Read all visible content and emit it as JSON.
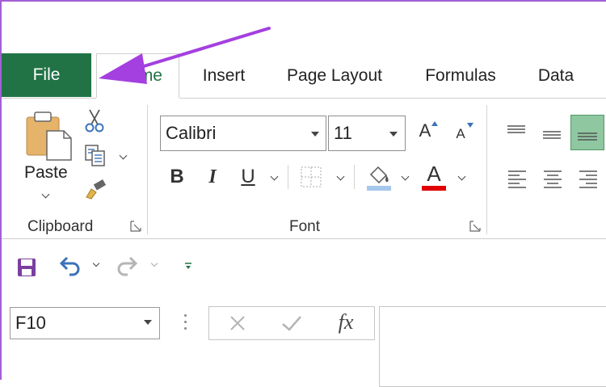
{
  "tabs": [
    {
      "id": "file",
      "label": "File"
    },
    {
      "id": "home",
      "label": "me"
    },
    {
      "id": "insert",
      "label": "Insert"
    },
    {
      "id": "page_layout",
      "label": "Page Layout"
    },
    {
      "id": "formulas",
      "label": "Formulas"
    },
    {
      "id": "data",
      "label": "Data"
    }
  ],
  "clipboard": {
    "paste_label": "Paste",
    "group_label": "Clipboard"
  },
  "font": {
    "font_name": "Calibri",
    "font_size": "11",
    "bold_label": "B",
    "italic_label": "I",
    "underline_label": "U",
    "increase_label": "A",
    "decrease_label": "A",
    "font_color_label": "A",
    "group_label": "Font"
  },
  "formula_bar": {
    "name_box": "F10",
    "fx_label": "fx"
  },
  "colors": {
    "file_tab": "#217346",
    "home_tab_text": "#217346",
    "arrow": "#a43fe0",
    "font_color_bar": "#e00000",
    "fill_color_bar": "#a6c8ec",
    "align_selected": "#8fc7a0"
  },
  "icons": {
    "paste": "clipboard-icon",
    "cut": "scissors-icon",
    "copy": "copy-icon",
    "format_painter": "paintbrush-icon",
    "save": "save-icon",
    "undo": "undo-icon",
    "redo": "redo-icon",
    "customize": "customize-qat-icon",
    "cancel": "x-icon",
    "enter": "checkmark-icon"
  }
}
